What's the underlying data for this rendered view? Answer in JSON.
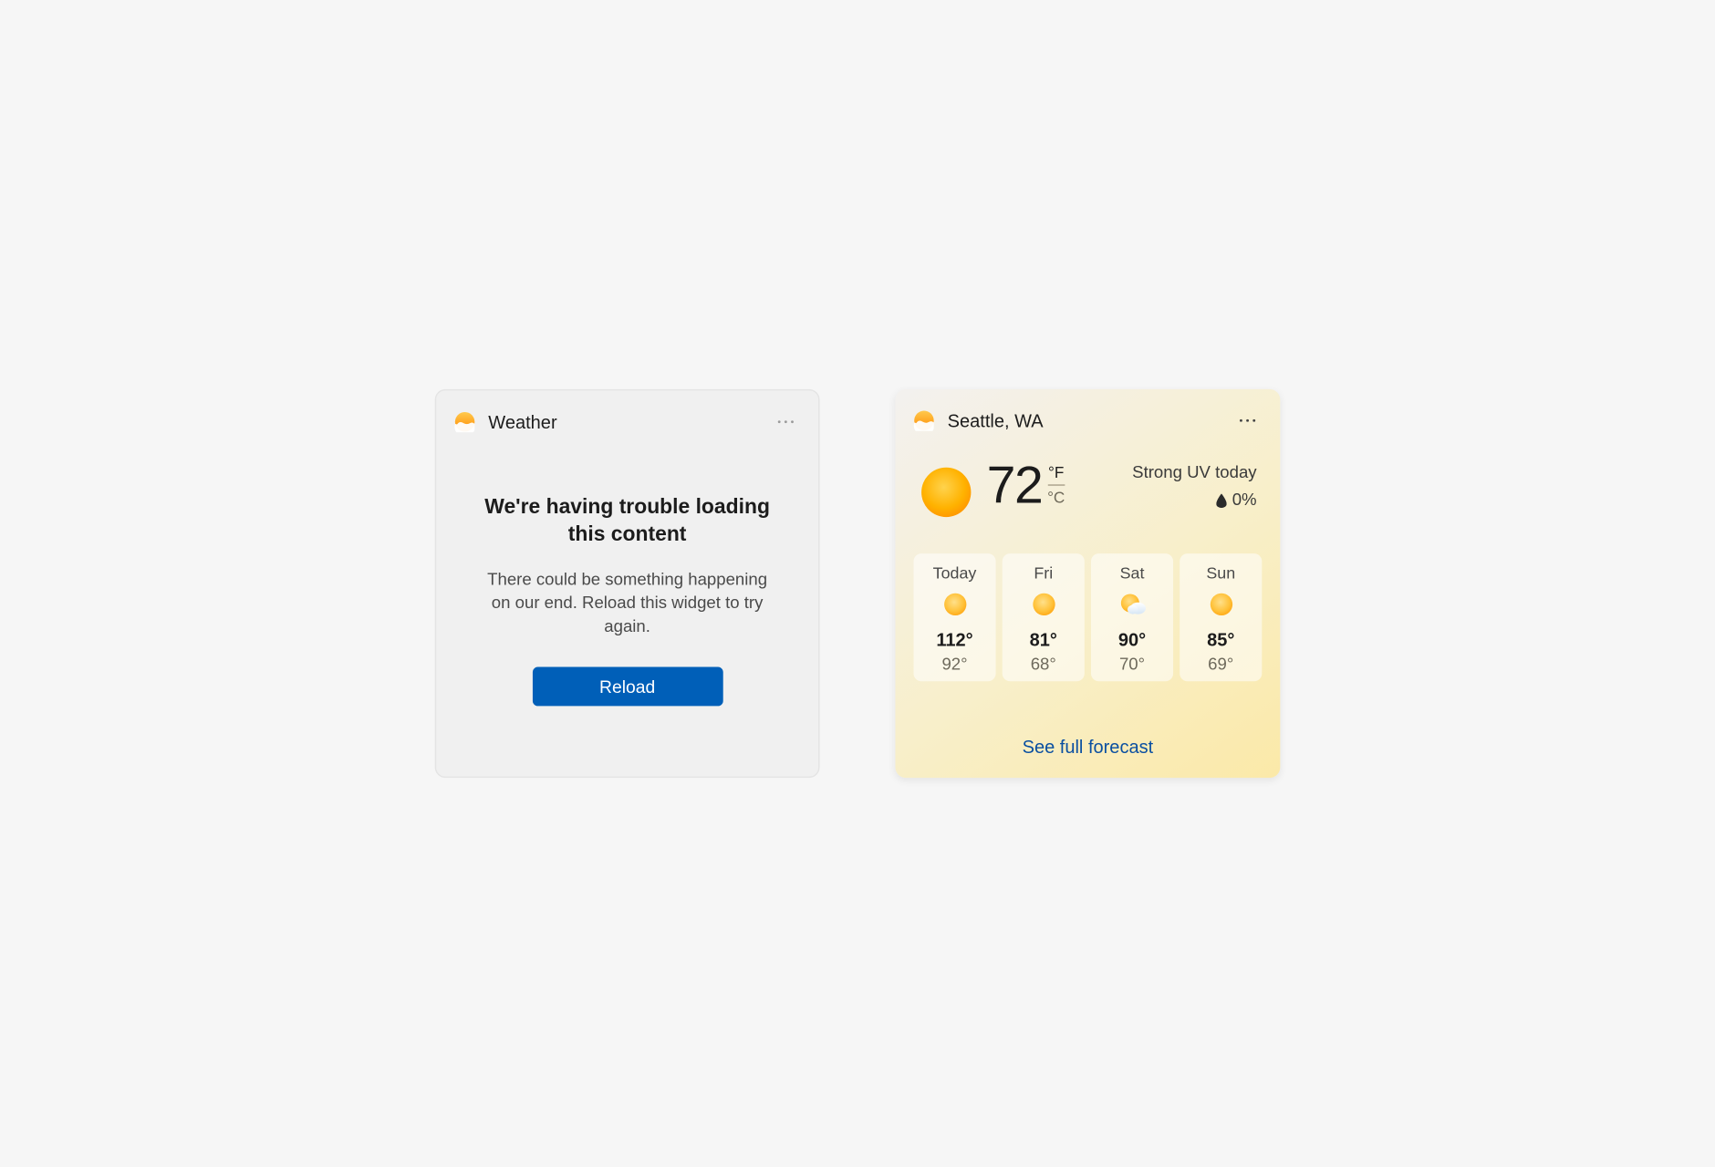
{
  "error_widget": {
    "header_title": "Weather",
    "title": "We're having trouble loading this content",
    "description": "There could be something happening on our end. Reload this widget to try again.",
    "reload_label": "Reload"
  },
  "weather_widget": {
    "header_title": "Seattle, WA",
    "current": {
      "temp": "72",
      "unit_f": "°F",
      "unit_c": "°C",
      "condition_icon": "sun",
      "uv_text": "Strong UV today",
      "precip_pct": "0%"
    },
    "forecast": [
      {
        "day": "Today",
        "icon": "sun",
        "hi": "112°",
        "lo": "92°"
      },
      {
        "day": "Fri",
        "icon": "sun",
        "hi": "81°",
        "lo": "68°"
      },
      {
        "day": "Sat",
        "icon": "partly-cloudy",
        "hi": "90°",
        "lo": "70°"
      },
      {
        "day": "Sun",
        "icon": "sun",
        "hi": "85°",
        "lo": "69°"
      }
    ],
    "full_forecast_label": "See full forecast"
  },
  "colors": {
    "accent": "#005fb8",
    "link": "#0a4fa1"
  }
}
